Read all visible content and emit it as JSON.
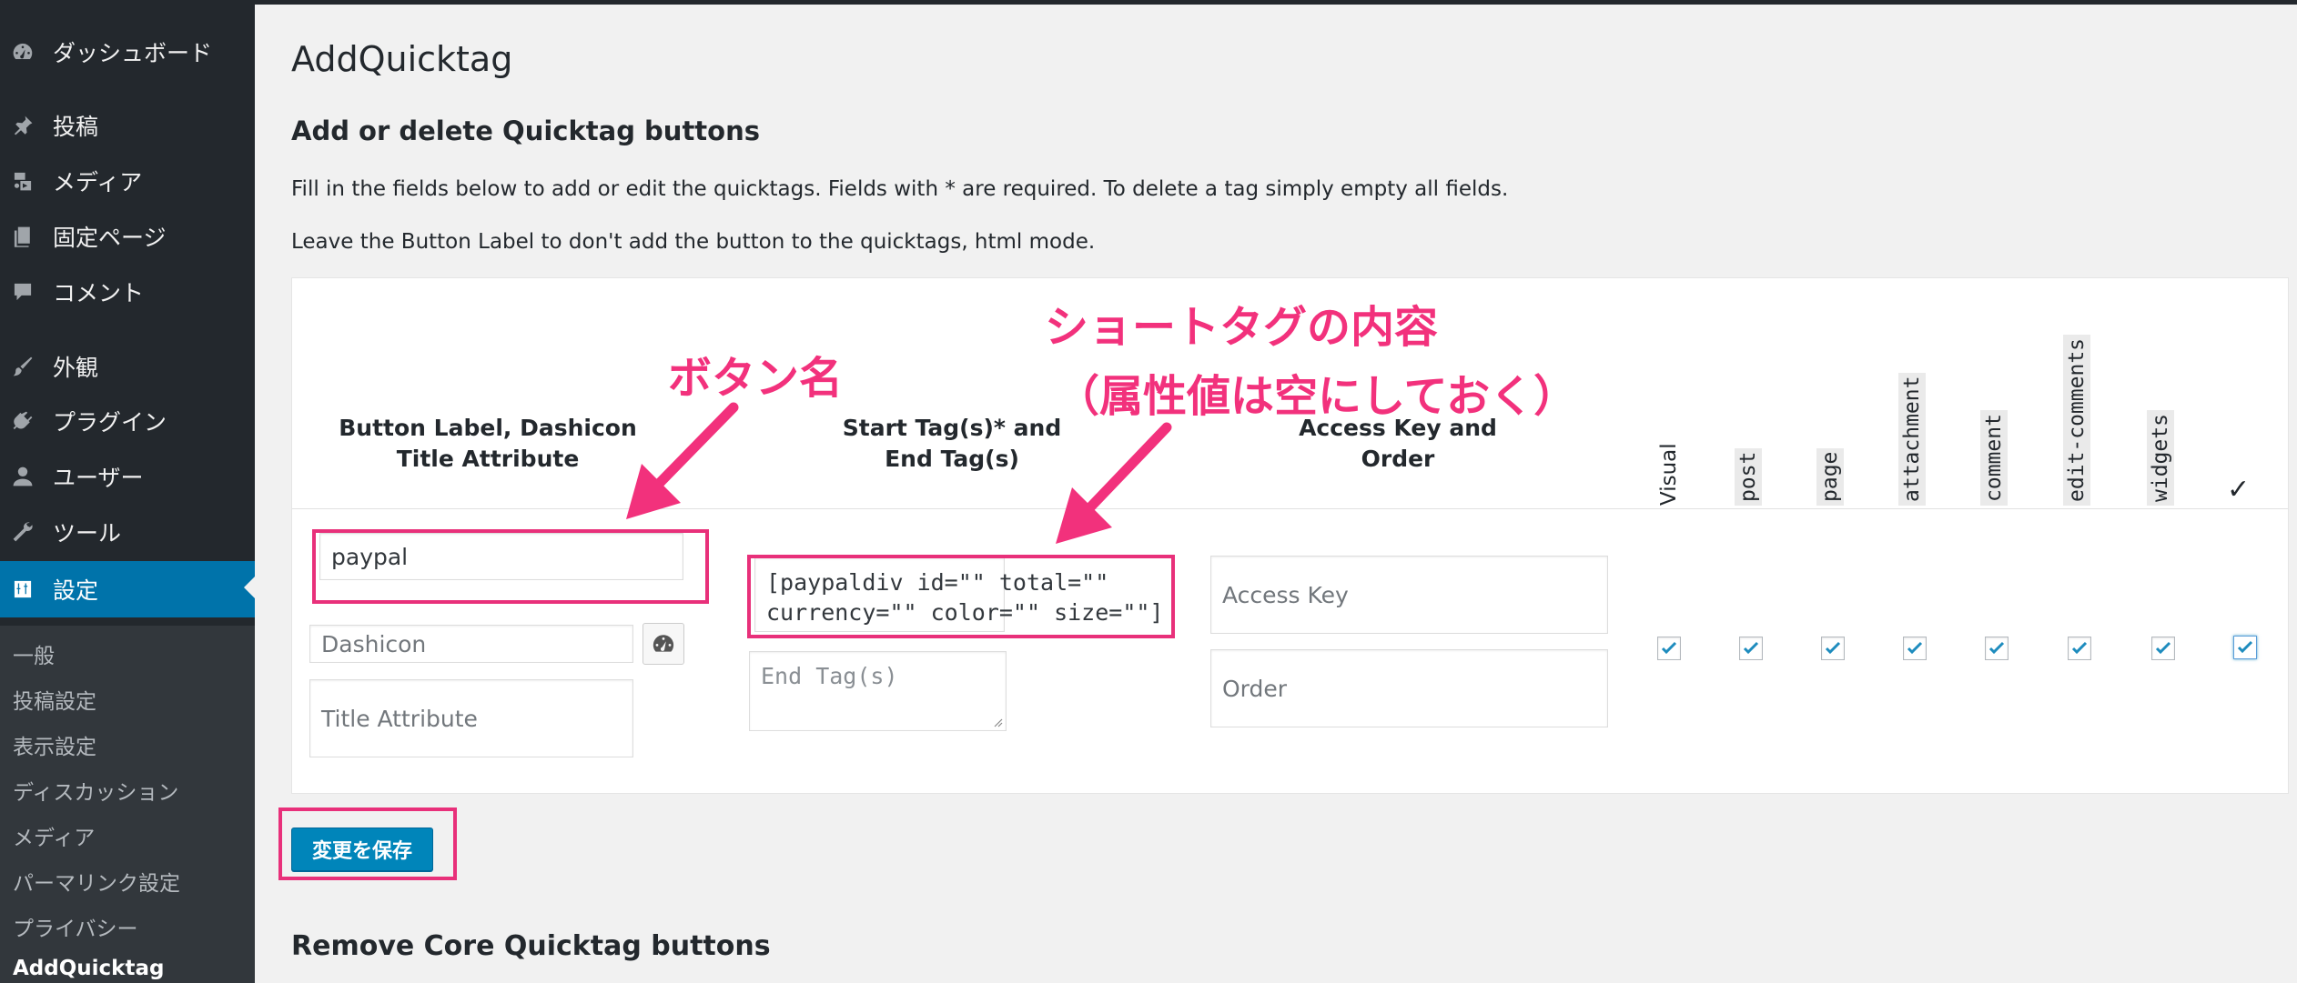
{
  "sidebar": {
    "items": [
      {
        "label": "ダッシュボード",
        "icon": "dashboard-icon"
      },
      {
        "label": "投稿",
        "icon": "pin-icon"
      },
      {
        "label": "メディア",
        "icon": "media-icon"
      },
      {
        "label": "固定ページ",
        "icon": "page-icon"
      },
      {
        "label": "コメント",
        "icon": "comment-icon"
      },
      {
        "label": "外観",
        "icon": "brush-icon"
      },
      {
        "label": "プラグイン",
        "icon": "plugin-icon"
      },
      {
        "label": "ユーザー",
        "icon": "user-icon"
      },
      {
        "label": "ツール",
        "icon": "wrench-icon"
      },
      {
        "label": "設定",
        "icon": "settings-icon"
      }
    ],
    "submenu": [
      "一般",
      "投稿設定",
      "表示設定",
      "ディスカッション",
      "メディア",
      "パーマリンク設定",
      "プライバシー",
      "AddQuicktag"
    ]
  },
  "page": {
    "title": "AddQuicktag",
    "section_title": "Add or delete Quicktag buttons",
    "desc1": "Fill in the fields below to add or edit the quicktags. Fields with * are required. To delete a tag simply empty all fields.",
    "desc2": "Leave the Button Label to don't add the button to the quicktags, html mode.",
    "remove_title": "Remove Core Quicktag buttons",
    "save_label": "変更を保存"
  },
  "table": {
    "col1_line1": "Button Label, Dashicon",
    "col1_line2": "Title Attribute",
    "col2_line1": "Start Tag(s)* and",
    "col2_line2": "End Tag(s)",
    "col3_line1": "Access Key and",
    "col3_line2": "Order",
    "post_types": [
      "Visual",
      "post",
      "page",
      "attachment",
      "comment",
      "edit-comments",
      "widgets"
    ],
    "row": {
      "button_label": "paypal",
      "dashicon_placeholder": "Dashicon",
      "title_attr_placeholder": "Title Attribute",
      "start_tag_line1": "[paypaldiv id=\"\" total=\"\"",
      "start_tag_line2": "currency=\"\" color=\"\" size=\"\"]",
      "end_tag_placeholder": "End Tag(s)",
      "access_key_placeholder": "Access Key",
      "order_placeholder": "Order",
      "checked": [
        true,
        true,
        true,
        true,
        true,
        true,
        true,
        true
      ]
    }
  },
  "annotations": {
    "button_name": "ボタン名",
    "shortcode_line1": "ショートタグの内容",
    "shortcode_line2": "（属性値は空にしておく）"
  },
  "colors": {
    "sidebar_bg": "#23282d",
    "accent": "#0073aa",
    "annotation": "#e8307a",
    "button": "#0085ba"
  }
}
